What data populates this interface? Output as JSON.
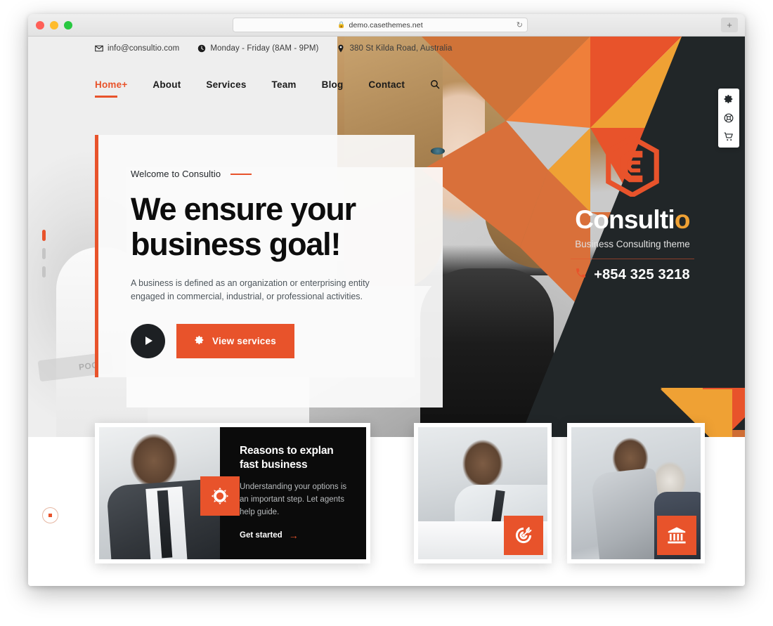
{
  "browser": {
    "url": "demo.casethemes.net",
    "lock_icon": "lock-icon",
    "reload_icon": "reload-icon",
    "newtab_label": "+"
  },
  "colors": {
    "accent_orange": "#e8532b",
    "accent_amber": "#efa134",
    "dark_panel": "#212628",
    "card_dark": "#0b0b0b"
  },
  "topbar": {
    "items": [
      {
        "icon": "envelope-icon",
        "text": "info@consultio.com"
      },
      {
        "icon": "clock-icon",
        "text": "Monday - Friday (8AM - 9PM)"
      },
      {
        "icon": "map-pin-icon",
        "text": "380 St Kilda Road, Australia"
      }
    ]
  },
  "nav": {
    "items": [
      {
        "label": "Home",
        "has_plus": true,
        "active": true
      },
      {
        "label": "About",
        "has_plus": false,
        "active": false
      },
      {
        "label": "Services",
        "has_plus": false,
        "active": false
      },
      {
        "label": "Team",
        "has_plus": false,
        "active": false
      },
      {
        "label": "Blog",
        "has_plus": false,
        "active": false
      },
      {
        "label": "Contact",
        "has_plus": false,
        "active": false
      }
    ],
    "plus_symbol": "+",
    "search_icon": "search-icon"
  },
  "hero": {
    "eyebrow": "Welcome to Consultio",
    "title": "We ensure your business goal!",
    "description": "A business is defined as an organization or enterprising entity engaged in commercial, industrial, or professional activities.",
    "play_button_icon": "play-icon",
    "cta_label": "View services",
    "cta_icon": "gear-icon"
  },
  "brand": {
    "logo_icon": "consultio-hex-c-logo",
    "name_main": "Consulti",
    "name_accent": "o",
    "tagline": "Business Consulting theme",
    "phone": "+854 325 3218",
    "phone_icon": "phone-icon"
  },
  "side_toolbar": {
    "buttons": [
      {
        "icon": "gear-icon",
        "name": "settings"
      },
      {
        "icon": "lifebuoy-icon",
        "name": "support"
      },
      {
        "icon": "cart-icon",
        "name": "cart"
      }
    ]
  },
  "slider": {
    "dots": [
      {
        "active": true
      },
      {
        "active": false
      },
      {
        "active": false
      }
    ]
  },
  "cards": [
    {
      "icon": "gear-wrench-icon",
      "title": "Reasons to explan fast business",
      "description": "Understanding your options is an important step. Let agents help guide.",
      "cta_label": "Get started",
      "cta_arrow": "→"
    },
    {
      "icon": "target-icon"
    },
    {
      "icon": "bank-icon"
    }
  ]
}
